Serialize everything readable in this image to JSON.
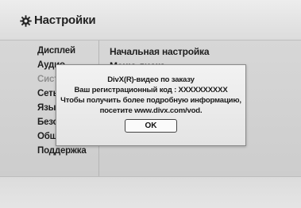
{
  "header": {
    "title": "Настройки",
    "icon": "gear-icon"
  },
  "menu": {
    "items": [
      {
        "label": "Дисплей",
        "dimmed": false
      },
      {
        "label": "Аудио",
        "dimmed": false
      },
      {
        "label": "Система",
        "dimmed": true
      },
      {
        "label": "Сеть",
        "dimmed": false
      },
      {
        "label": "Язык",
        "dimmed": false
      },
      {
        "label": "Безопасн",
        "dimmed": false
      },
      {
        "label": "Общее",
        "dimmed": false
      },
      {
        "label": "Поддержка",
        "dimmed": false
      }
    ]
  },
  "submenu": {
    "items": [
      {
        "label": "Начальная настройка"
      },
      {
        "label": "Меню диска"
      }
    ]
  },
  "popup": {
    "line1": "DivX(R)-видео по заказу",
    "line2": "Ваш регистрационный код : XXXXXXXXXX",
    "line3": "Чтобы получить более подробную информацию,",
    "line4": "посетите www.divx.com/vod.",
    "ok_label": "OK"
  }
}
